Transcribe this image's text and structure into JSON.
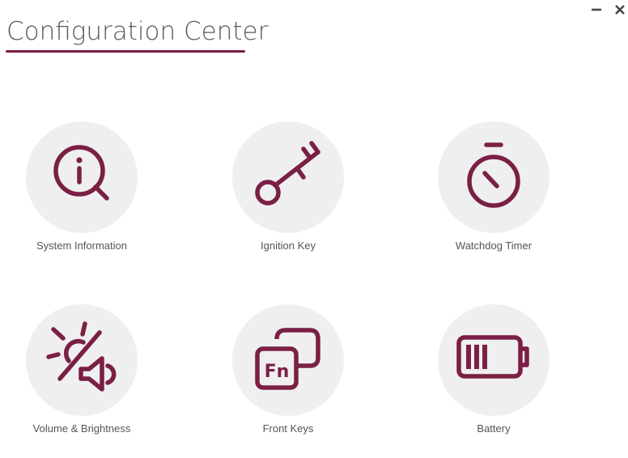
{
  "header": {
    "title": "Configuration Center"
  },
  "window_controls": {
    "minimize_icon": "minimize-icon",
    "close_icon": "close-icon"
  },
  "colors": {
    "accent": "#7a1f45",
    "tile_background": "#efefef",
    "title_text": "#5a5a5a",
    "label_text": "#555555",
    "window_control": "#4a4a4a"
  },
  "tiles": [
    {
      "label": "System Information",
      "icon": "info-search-icon"
    },
    {
      "label": "Ignition Key",
      "icon": "key-icon"
    },
    {
      "label": "Watchdog Timer",
      "icon": "stopwatch-icon"
    },
    {
      "label": "Volume & Brightness",
      "icon": "brightness-volume-icon"
    },
    {
      "label": "Front Keys",
      "icon": "fn-keys-icon"
    },
    {
      "label": "Battery",
      "icon": "battery-icon"
    }
  ]
}
